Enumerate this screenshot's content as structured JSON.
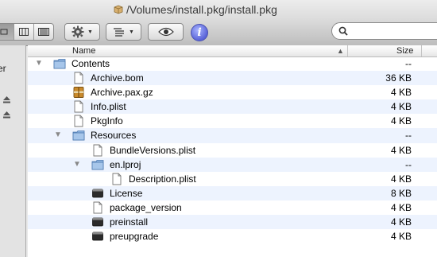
{
  "window": {
    "title": "/Volumes/install.pkg/install.pkg"
  },
  "sidebar": {
    "partial_label": "er"
  },
  "toolbar": {
    "info_glyph": "i"
  },
  "columns": {
    "name": "Name",
    "size": "Size"
  },
  "files": [
    {
      "name": "Contents",
      "size": "--",
      "type": "folder",
      "depth": 0,
      "expanded": true
    },
    {
      "name": "Archive.bom",
      "size": "36 KB",
      "type": "doc",
      "depth": 1
    },
    {
      "name": "Archive.pax.gz",
      "size": "4 KB",
      "type": "archive",
      "depth": 1
    },
    {
      "name": "Info.plist",
      "size": "4 KB",
      "type": "doc",
      "depth": 1
    },
    {
      "name": "PkgInfo",
      "size": "4 KB",
      "type": "doc",
      "depth": 1
    },
    {
      "name": "Resources",
      "size": "--",
      "type": "folder",
      "depth": 1,
      "expanded": true
    },
    {
      "name": "BundleVersions.plist",
      "size": "4 KB",
      "type": "doc",
      "depth": 2
    },
    {
      "name": "en.lproj",
      "size": "--",
      "type": "folder",
      "depth": 2,
      "expanded": true
    },
    {
      "name": "Description.plist",
      "size": "4 KB",
      "type": "doc",
      "depth": 3
    },
    {
      "name": "License",
      "size": "8 KB",
      "type": "exec",
      "depth": 2
    },
    {
      "name": "package_version",
      "size": "4 KB",
      "type": "doc",
      "depth": 2
    },
    {
      "name": "preinstall",
      "size": "4 KB",
      "type": "exec",
      "depth": 2
    },
    {
      "name": "preupgrade",
      "size": "4 KB",
      "type": "exec",
      "depth": 2
    }
  ],
  "colors": {
    "stripe": "#edf3fe",
    "folder": "#6d95c6",
    "exec": "#2b2b2b"
  }
}
